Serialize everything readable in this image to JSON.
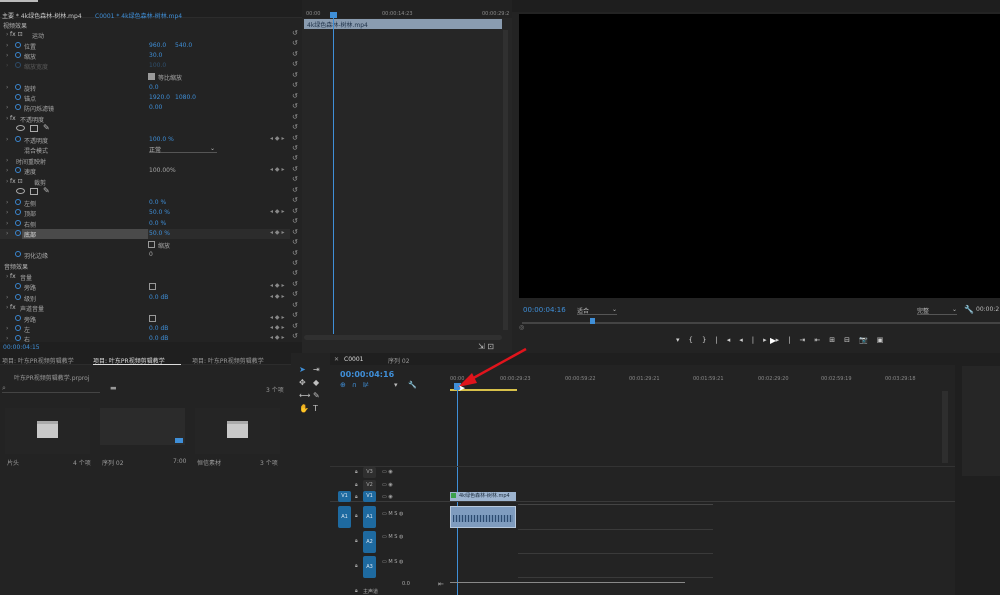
{
  "source_tabs": {
    "main": "主要 * 4k绿色森林-树林.mp4",
    "clip": "C0001 * 4k绿色森林-树林.mp4"
  },
  "effect_controls": {
    "ruler": [
      "00:00",
      "00:00:14:23",
      "00:00:29:2"
    ],
    "clip_name": "4k绿色森林-树林.mp4",
    "video_effects": "视频效果",
    "motion": "运动",
    "position": {
      "label": "位置",
      "x": "960.0",
      "y": "540.0"
    },
    "scale": {
      "label": "缩放",
      "value": "30.0"
    },
    "scale_width": {
      "label": "缩放宽度",
      "value": "100.0"
    },
    "uniform": "等比缩放",
    "rotation": {
      "label": "旋转",
      "value": "0.0"
    },
    "anchor": {
      "label": "锚点",
      "x": "1920.0",
      "y": "1080.0"
    },
    "antiflicker": {
      "label": "防闪烁滤镜",
      "value": "0.00"
    },
    "opacity_sec": "不透明度",
    "opacity": {
      "label": "不透明度",
      "value": "100.0 %"
    },
    "blend": {
      "label": "混合模式",
      "value": "正常"
    },
    "time_remap": "时间重映射",
    "speed": {
      "label": "速度",
      "value": "100.00%"
    },
    "crop": "裁剪",
    "left": {
      "label": "左侧",
      "value": "0.0 %"
    },
    "top": {
      "label": "顶部",
      "value": "50.0 %"
    },
    "right": {
      "label": "右侧",
      "value": "0.0 %"
    },
    "bottom": {
      "label": "底部",
      "value": "50.0 %"
    },
    "zoom": "缩放",
    "feather": {
      "label": "羽化边缘",
      "value": "0"
    },
    "audio_effects": "音频效果",
    "volume_sec": "音量",
    "bypass": {
      "label": "旁路"
    },
    "level": {
      "label": "级别",
      "value": "0.0 dB"
    },
    "channel_vol": "声道音量",
    "bypass2": {
      "label": "旁路"
    },
    "left_ch": {
      "label": "左",
      "value": "0.0 dB"
    },
    "right_ch": {
      "label": "右",
      "value": "0.0 dB"
    },
    "timecode": "00:00:04:15"
  },
  "program": {
    "timecode": "00:00:04:16",
    "fit": "适合",
    "quality": "完整",
    "timecode_right": "00:00:2"
  },
  "project": {
    "tabs": [
      "项目: 叶东PR视频剪辑教学",
      "项目: 叶东PR视频剪辑教学",
      "项目: 叶东PR视频剪辑教学"
    ],
    "file": "叶东PR视频剪辑教学.prproj",
    "count": "3 个项",
    "bins": [
      {
        "name": "片头",
        "meta": "4 个项"
      },
      {
        "name": "序列 02",
        "meta": "7:00"
      },
      {
        "name": "恒信素材",
        "meta": "3 个项"
      }
    ]
  },
  "timeline": {
    "tabs": [
      "C0001",
      "序列 02"
    ],
    "timecode": "00:00:04:16",
    "ruler": [
      "00:00",
      "00:00:29:23",
      "00:00:59:22",
      "00:01:29:21",
      "00:01:59:21",
      "00:02:29:20",
      "00:02:59:19",
      "00:03:29:18"
    ],
    "tracks": [
      "V3",
      "V2",
      "V1",
      "A1",
      "A2",
      "A3"
    ],
    "src_v": "V1",
    "src_a": "A1",
    "clip_name": "4k绿色森林-树林.mp4",
    "master": "主声道",
    "master_val": "0.0"
  }
}
